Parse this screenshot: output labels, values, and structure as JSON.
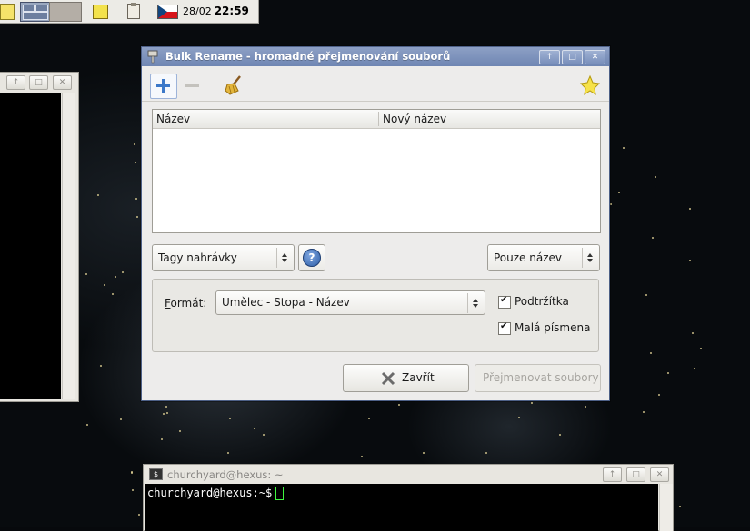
{
  "panel": {
    "date": "28/02",
    "time": "22:59",
    "icons": [
      "workspace-icon",
      "pager-icon",
      "notes-icon",
      "clipboard-icon",
      "czech-flag-icon"
    ]
  },
  "dialog": {
    "title": "Bulk Rename - hromadné přejmenování souborů",
    "title_buttons": [
      "↑",
      "□",
      "✕"
    ],
    "toolbar": [
      "add-files-icon",
      "remove-files-icon",
      "clear-broom-icon",
      "about-star-icon"
    ],
    "columns": [
      "Název",
      "Nový název"
    ],
    "renamer_select": "Tagy nahrávky",
    "help_label": "?",
    "scope_select": "Pouze název",
    "format_label_prefix": "F",
    "format_label_rest": "ormát:",
    "format_value": "Umělec - Stopa - Název",
    "options": [
      {
        "label": "Podtržítka",
        "checked": true
      },
      {
        "label": "Malá písmena",
        "checked": true
      }
    ],
    "close_button": "Zavřít",
    "rename_button": "Přejmenovat soubory"
  },
  "left_window": {
    "title_buttons": [
      "↑",
      "□",
      "✕"
    ]
  },
  "terminal": {
    "title": "churchyard@hexus: ~",
    "prompt": "churchyard@hexus:~$",
    "title_buttons": [
      "↑",
      "□",
      "✕"
    ]
  },
  "colors": {
    "titlebar_active": "#7a90bc",
    "accent_blue": "#3c78c8",
    "terminal_cursor": "#3ef53e"
  }
}
